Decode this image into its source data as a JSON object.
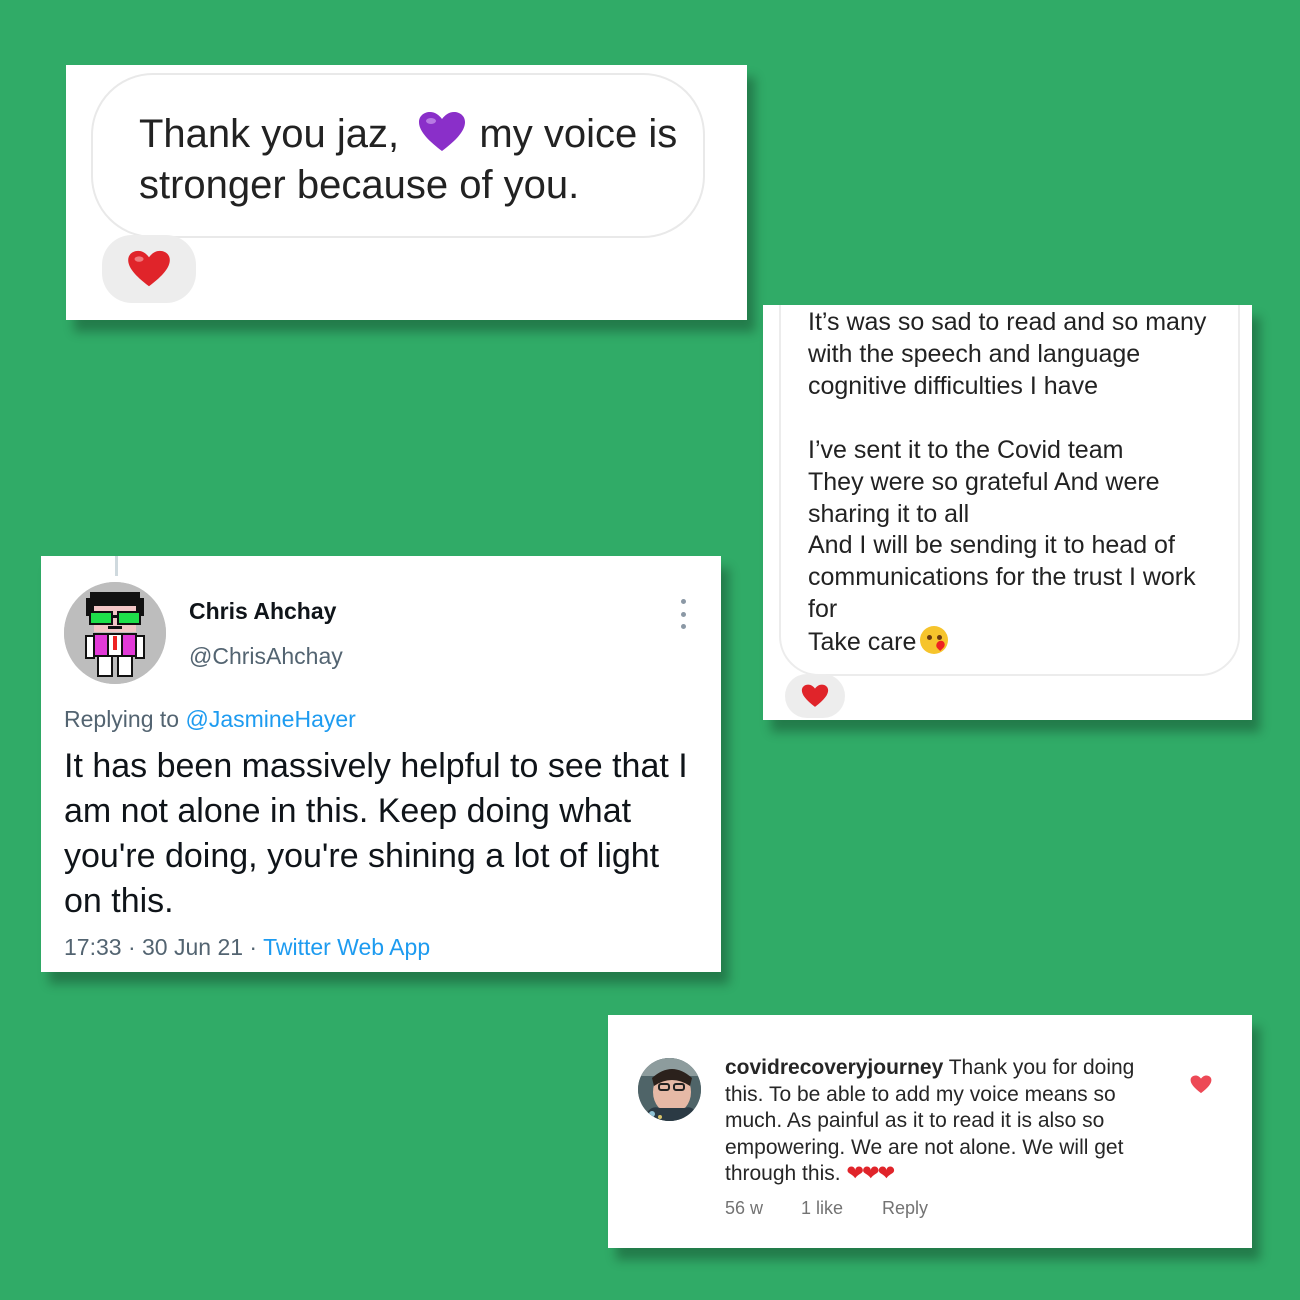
{
  "colors": {
    "background": "#30ab67",
    "heart": "#e0242a",
    "twitter_blue": "#1d9bf0",
    "muted": "#536471"
  },
  "card1": {
    "message_before": "Thank you jaz,",
    "emoji": "purple-heart",
    "message_after": " my voice is stronger because of you.",
    "reaction": "red-heart"
  },
  "card2": {
    "lines_1": "It’s was so sad to read and so many with the speech and language cognitive difficulties I have",
    "lines_2": "I’ve sent it to the Covid team",
    "lines_3": "They were so grateful And  were sharing it to all",
    "lines_4": "And I will be sending it to head of communications for the trust I work for",
    "lines_5": "Take care",
    "emoji": "face-blowing-kiss",
    "reaction": "red-heart"
  },
  "card3": {
    "name": "Chris Ahchay",
    "handle": "@ChrisAhchay",
    "replying_prefix": "Replying to ",
    "replying_to": "@JasmineHayer",
    "tweet": "It has been massively helpful to see that I am not alone in this. Keep doing what you're doing, you're shining a lot of light on this.",
    "timestamp": "17:33 · 30 Jun 21 · ",
    "source": "Twitter Web App"
  },
  "card4": {
    "username": "covidrecoveryjourney",
    "comment": "Thank you for doing this. To be able to add my voice means so much. As painful as it to read it is also so empowering. We are not alone. We will get through this. ",
    "emoji": "❤❤❤",
    "age": "56 w",
    "likes": "1 like",
    "reply": "Reply"
  }
}
